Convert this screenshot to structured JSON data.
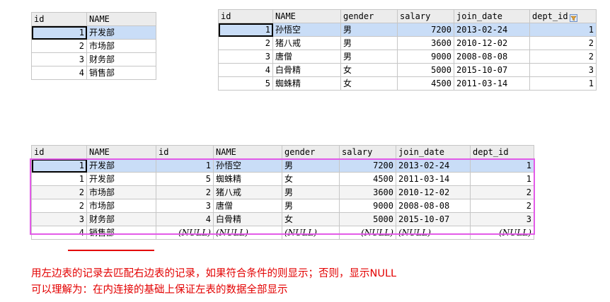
{
  "dept_table": {
    "columns": [
      "id",
      "NAME"
    ],
    "rows": [
      [
        "1",
        "开发部"
      ],
      [
        "2",
        "市场部"
      ],
      [
        "3",
        "财务部"
      ],
      [
        "4",
        "销售部"
      ]
    ]
  },
  "emp_table": {
    "columns": [
      "id",
      "NAME",
      "gender",
      "salary",
      "join_date",
      "dept_id"
    ],
    "rows": [
      [
        "1",
        "孙悟空",
        "男",
        "7200",
        "2013-02-24",
        "1"
      ],
      [
        "2",
        "猪八戒",
        "男",
        "3600",
        "2010-12-02",
        "2"
      ],
      [
        "3",
        "唐僧",
        "男",
        "9000",
        "2008-08-08",
        "2"
      ],
      [
        "4",
        "白骨精",
        "女",
        "5000",
        "2015-10-07",
        "3"
      ],
      [
        "5",
        "蜘蛛精",
        "女",
        "4500",
        "2011-03-14",
        "1"
      ]
    ]
  },
  "join_table": {
    "columns": [
      "id",
      "NAME",
      "id",
      "NAME",
      "gender",
      "salary",
      "join_date",
      "dept_id"
    ],
    "rows": [
      [
        "1",
        "开发部",
        "1",
        "孙悟空",
        "男",
        "7200",
        "2013-02-24",
        "1"
      ],
      [
        "1",
        "开发部",
        "5",
        "蜘蛛精",
        "女",
        "4500",
        "2011-03-14",
        "1"
      ],
      [
        "2",
        "市场部",
        "2",
        "猪八戒",
        "男",
        "3600",
        "2010-12-02",
        "2"
      ],
      [
        "2",
        "市场部",
        "3",
        "唐僧",
        "男",
        "9000",
        "2008-08-08",
        "2"
      ],
      [
        "3",
        "财务部",
        "4",
        "白骨精",
        "女",
        "5000",
        "2015-10-07",
        "3"
      ],
      [
        "4",
        "销售部",
        "(NULL)",
        "(NULL)",
        "(NULL)",
        "(NULL)",
        "(NULL)",
        "(NULL)"
      ]
    ]
  },
  "notes": {
    "line1": "用左边表的记录去匹配右边表的记录，如果符合条件的则显示；否则，显示NULL",
    "line2": "可以理解为：在内连接的基础上保证左表的数据全部显示"
  },
  "colors": {
    "highlight_box": "#e35be8",
    "annotation_red": "#e30000",
    "selected_row": "#c9ddf7"
  }
}
